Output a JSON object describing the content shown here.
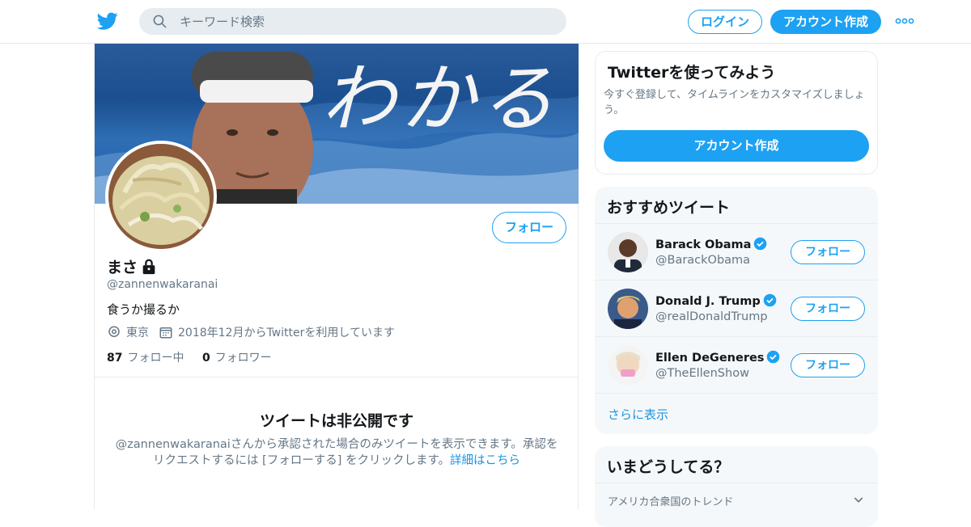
{
  "header": {
    "search_placeholder": "キーワード検索",
    "login_label": "ログイン",
    "signup_label": "アカウント作成"
  },
  "profile": {
    "banner_text": "わかる",
    "display_name": "まさ",
    "handle": "@zannenwakaranai",
    "bio": "食うか撮るか",
    "location": "東京",
    "joined": "2018年12月からTwitterを利用しています",
    "following_count": "87",
    "following_label": "フォロー中",
    "followers_count": "0",
    "followers_label": "フォロワー",
    "follow_label": "フォロー",
    "private_title": "ツイートは非公開です",
    "private_desc": "@zannenwakaranaiさんから承認された場合のみツイートを表示できます。承認をリクエストするには [フォローする] をクリックします。",
    "private_link": "詳細はこちら"
  },
  "signup_card": {
    "title": "Twitterを使ってみよう",
    "desc": "今すぐ登録して、タイムラインをカスタマイズしましょう。",
    "button": "アカウント作成"
  },
  "recommended": {
    "title": "おすすめツイート",
    "items": [
      {
        "name": "Barack Obama",
        "handle": "@BarackObama",
        "follow": "フォロー"
      },
      {
        "name": "Donald J. Trump",
        "handle": "@realDonaldTrump",
        "follow": "フォロー"
      },
      {
        "name": "Ellen DeGeneres",
        "handle": "@TheEllenShow",
        "follow": "フォロー"
      }
    ],
    "more": "さらに表示"
  },
  "trends": {
    "title": "いまどうしてる？",
    "region": "アメリカ合衆国のトレンド"
  },
  "colors": {
    "accent": "#1da1f2",
    "link": "#1b95e0",
    "muted": "#657786"
  }
}
